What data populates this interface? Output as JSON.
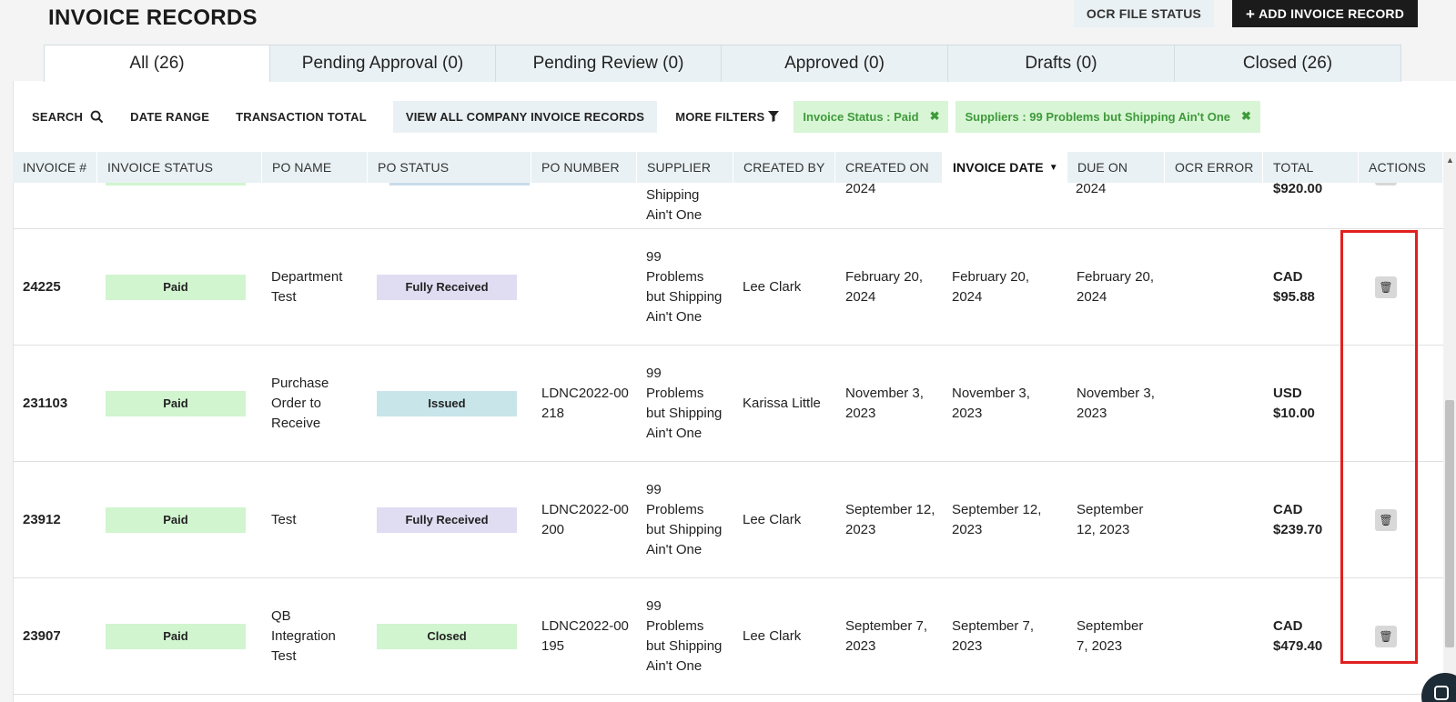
{
  "page": {
    "title": "INVOICE RECORDS"
  },
  "header_buttons": {
    "ocr_status": "OCR FILE STATUS",
    "add_record": "ADD INVOICE RECORD",
    "add_icon": "+"
  },
  "tabs": [
    {
      "label": "All (26)",
      "active": true
    },
    {
      "label": "Pending Approval (0)",
      "active": false
    },
    {
      "label": "Pending Review (0)",
      "active": false
    },
    {
      "label": "Approved (0)",
      "active": false
    },
    {
      "label": "Drafts (0)",
      "active": false
    },
    {
      "label": "Closed (26)",
      "active": false
    }
  ],
  "filters": {
    "search": "SEARCH",
    "date_range": "DATE RANGE",
    "transaction_total": "TRANSACTION TOTAL",
    "view_all": "VIEW ALL COMPANY INVOICE RECORDS",
    "more_filters": "MORE FILTERS",
    "chips": [
      {
        "label": "Invoice Status : Paid",
        "close": "✖"
      },
      {
        "label": "Suppliers : 99 Problems but Shipping Ain't One",
        "close": "✖"
      }
    ]
  },
  "table": {
    "columns": [
      "INVOICE #",
      "INVOICE STATUS",
      "PO NAME",
      "PO STATUS",
      "PO NUMBER",
      "SUPPLIER",
      "CREATED BY",
      "CREATED ON",
      "INVOICE DATE",
      "DUE ON",
      "OCR ERROR",
      "TOTAL",
      "ACTIONS"
    ],
    "sorted_column": "INVOICE DATE",
    "partial_row": {
      "supplier": "Shipping\nAin't One",
      "created_on": "2024",
      "due_on": "2024",
      "total": "$920.00"
    },
    "rows": [
      {
        "invoice": "24225",
        "status": "Paid",
        "po_name": "Department Test",
        "po_status": "Fully Received",
        "po_number": "",
        "supplier": "99 Problems but Shipping Ain't One",
        "created_by": "Lee Clark",
        "created_on": "February 20, 2024",
        "invoice_date": "February 20, 2024",
        "due_on": "February 20, 2024",
        "ocr_error": "",
        "total_currency": "CAD",
        "total_amount": "$95.88",
        "has_delete": true
      },
      {
        "invoice": "231103",
        "status": "Paid",
        "po_name": "Purchase Order to Receive",
        "po_status": "Issued",
        "po_number": "LDNC2022-00218",
        "supplier": "99 Problems but Shipping Ain't One",
        "created_by": "Karissa Little",
        "created_on": "November 3, 2023",
        "invoice_date": "November 3, 2023",
        "due_on": "November 3, 2023",
        "ocr_error": "",
        "total_currency": "USD",
        "total_amount": "$10.00",
        "has_delete": false
      },
      {
        "invoice": "23912",
        "status": "Paid",
        "po_name": "Test",
        "po_status": "Fully Received",
        "po_number": "LDNC2022-00200",
        "supplier": "99 Problems but Shipping Ain't One",
        "created_by": "Lee Clark",
        "created_on": "September 12, 2023",
        "invoice_date": "September 12, 2023",
        "due_on": "September 12, 2023",
        "ocr_error": "",
        "total_currency": "CAD",
        "total_amount": "$239.70",
        "has_delete": true
      },
      {
        "invoice": "23907",
        "status": "Paid",
        "po_name": "QB Integration Test",
        "po_status": "Closed",
        "po_number": "LDNC2022-00195",
        "supplier": "99 Problems but Shipping Ain't One",
        "created_by": "Lee Clark",
        "created_on": "September 7, 2023",
        "invoice_date": "September 7, 2023",
        "due_on": "September 7, 2023",
        "ocr_error": "",
        "total_currency": "CAD",
        "total_amount": "$479.40",
        "has_delete": true
      }
    ]
  },
  "colors": {
    "paid": "#d1f5cf",
    "fully_received": "#e0dcf2",
    "issued": "#c8e5ea",
    "closed": "#d1f5cf",
    "highlight": "#e02020"
  },
  "icons": {
    "search": "search-icon",
    "filter": "filter-icon",
    "sort_caret": "sort-desc-icon",
    "delete": "trash-icon"
  }
}
